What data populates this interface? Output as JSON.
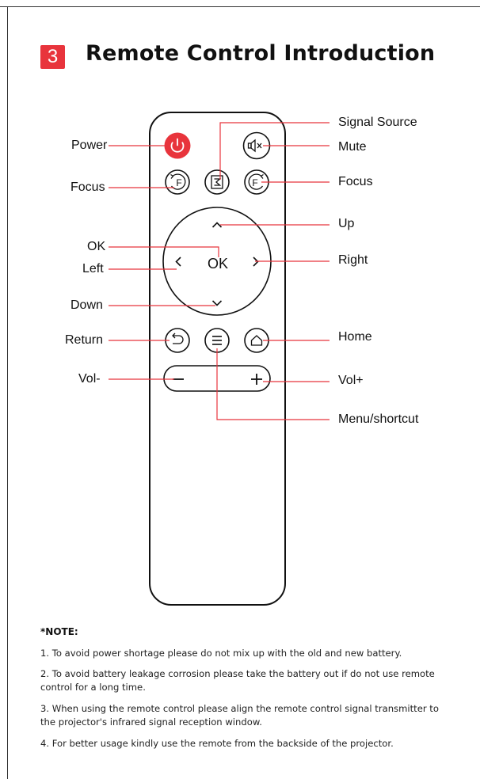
{
  "section": {
    "number": "3",
    "title": "Remote Control Introduction"
  },
  "remote": {
    "ok_text": "OK",
    "focus_letter": "F",
    "left_labels": {
      "power": "Power",
      "focus": "Focus",
      "ok": "OK",
      "left": "Left",
      "down": "Down",
      "return": "Return",
      "vol_minus": "Vol-"
    },
    "right_labels": {
      "signal_source": "Signal Source",
      "mute": "Mute",
      "focus": "Focus",
      "up": "Up",
      "right": "Right",
      "home": "Home",
      "vol_plus": "Vol+",
      "menu": "Menu/shortcut"
    },
    "colors": {
      "accent": "#e8343c",
      "line": "#e8343c",
      "outline": "#111111"
    }
  },
  "notes": {
    "heading": "*NOTE:",
    "items": [
      "1. To avoid power shortage please do not mix up with the old and new battery.",
      "2. To avoid battery leakage corrosion please take the battery out if do not use remote control for a long time.",
      "3. When using the remote control please align the remote control signal transmitter to the projector's infrared signal reception window.",
      "4. For better usage kindly use the remote from the backside of the projector."
    ]
  }
}
